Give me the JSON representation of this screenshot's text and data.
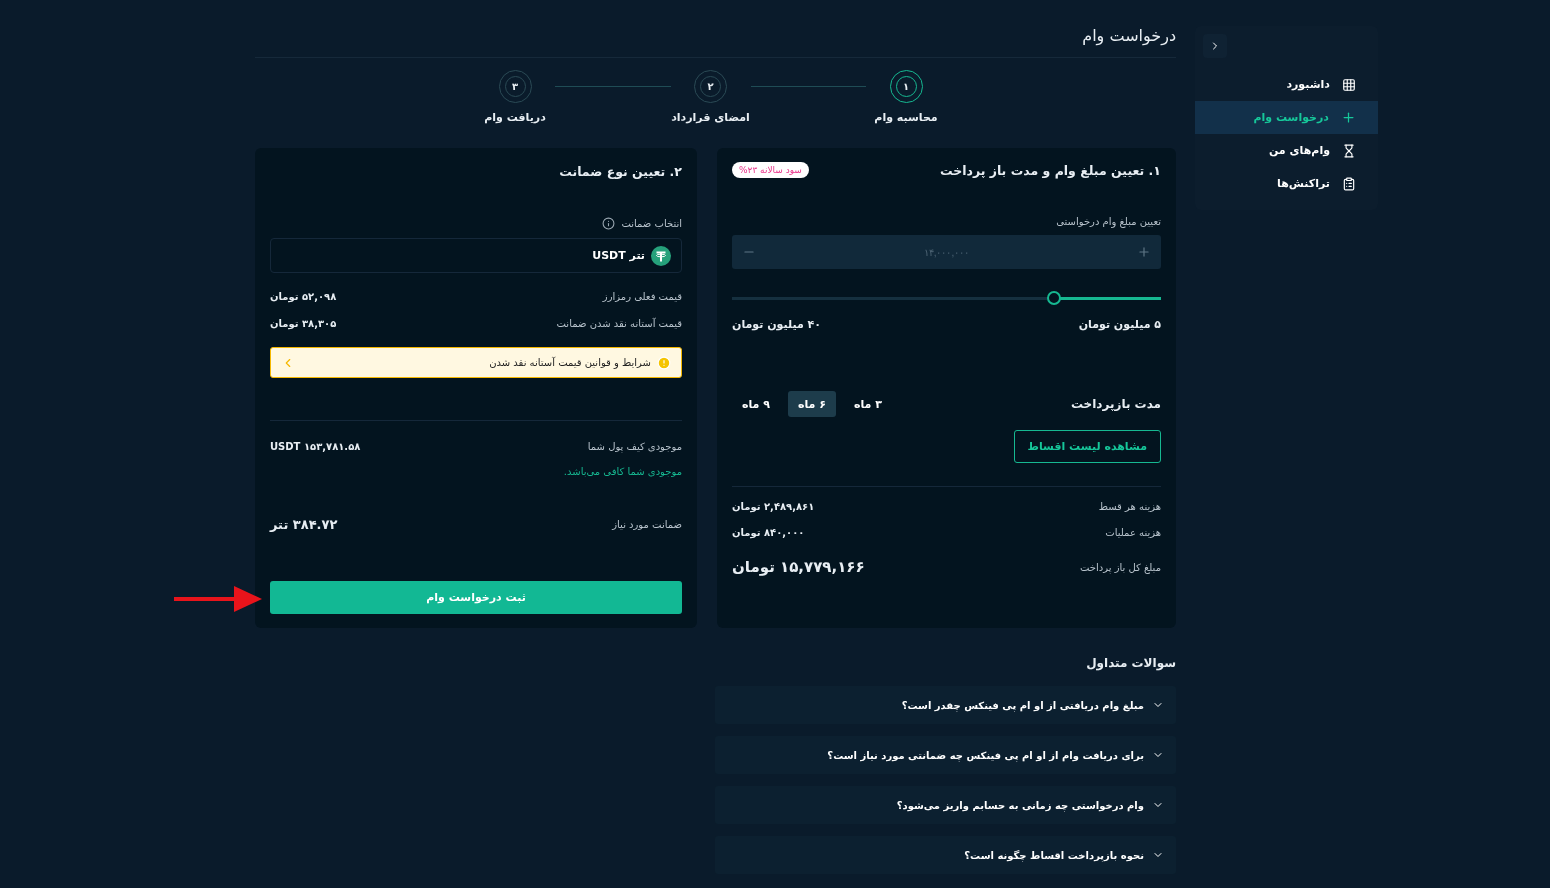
{
  "sidebar": {
    "items": [
      {
        "label": "داشبورد",
        "kind": "grid",
        "selected": false
      },
      {
        "label": "درخواست وام",
        "kind": "plus",
        "selected": true
      },
      {
        "label": "وام‌های من",
        "kind": "hourglass",
        "selected": false
      },
      {
        "label": "تراکنش‌ها",
        "kind": "clipboard",
        "selected": false
      }
    ]
  },
  "page_title": "درخواست وام",
  "steps": [
    {
      "number": "۱",
      "label": "محاسبه وام",
      "active": true
    },
    {
      "number": "۲",
      "label": "امضای قرارداد",
      "active": false
    },
    {
      "number": "۳",
      "label": "دریافت وام",
      "active": false
    }
  ],
  "calculator": {
    "title": "۱. تعیین مبلغ وام و مدت باز پرداخت",
    "badge": "سود سالانه ۲۳%",
    "amount_label": "تعیین مبلغ وام درخواستی",
    "amount_placeholder": "۱۴,۰۰۰,۰۰۰",
    "slider": {
      "level": 0.25,
      "min_label": "۵ میلیون تومان",
      "max_label": "۴۰ میلیون تومان"
    },
    "period_label": "مدت بازپرداخت",
    "periods": [
      {
        "label": "۳ ماه",
        "selected": false
      },
      {
        "label": "۶ ماه",
        "selected": true
      },
      {
        "label": "۹ ماه",
        "selected": false
      }
    ],
    "installments_button": "مشاهده لیست اقساط",
    "rows": [
      {
        "label": "هزینه هر قسط",
        "value": "۲,۴۸۹,۸۶۱ تومان"
      },
      {
        "label": "هزینه عملیات",
        "value": "۸۴۰,۰۰۰ تومان"
      }
    ],
    "total": {
      "label": "مبلغ کل باز پرداخت",
      "value": "۱۵,۷۷۹,۱۶۶ تومان"
    }
  },
  "collateral": {
    "title": "۲. تعیین نوع ضمانت",
    "select_label": "انتخاب ضمانت",
    "selected_asset": "تتر USDT",
    "rows": [
      {
        "label": "قیمت فعلی رمزارز",
        "value": "۵۲,۰۹۸ تومان"
      },
      {
        "label": "قیمت آستانه نقد شدن ضمانت",
        "value": "۳۸,۳۰۵ تومان"
      }
    ],
    "notice": "شرایط و قوانین قیمت آستانه نقد شدن",
    "wallet_label": "موجودی کیف پول شما",
    "wallet_value": "۱۵۳,۷۸۱.۵۸ USDT",
    "wallet_status": "موجودی شما کافی می‌باشد.",
    "required_label": "ضمانت مورد نیاز",
    "required_value": "۳۸۴.۷۲ تتر",
    "submit": "ثبت درخواست وام"
  },
  "faq": {
    "title": "سوالات متداول",
    "items": [
      {
        "question": "مبلغ وام دریافتی از او ام پی فینکس چقدر است؟",
        "expanded": false
      },
      {
        "question": "برای دریافت وام از او ام پی فینکس چه ضمانتی مورد نیاز است؟",
        "expanded": false
      },
      {
        "question": "وام درخواستی چه زمانی به حسابم واریز می‌شود؟",
        "expanded": false
      },
      {
        "question": "نحوه بازپرداخت اقساط چگونه است؟",
        "expanded": false
      }
    ]
  }
}
